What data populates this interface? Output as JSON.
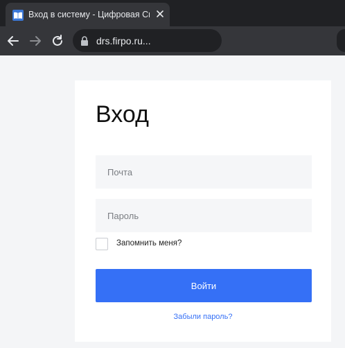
{
  "browser": {
    "tab_title": "Вход в систему - Цифровая Сис",
    "url": "drs.firpo.ru...",
    "accent_color": "#3b78d8"
  },
  "login": {
    "heading": "Вход",
    "email_placeholder": "Почта",
    "password_placeholder": "Пароль",
    "remember_label": "Запомнить меня?",
    "submit_label": "Войти",
    "forgot_link": "Забыли пароль?",
    "button_color": "#3570f6"
  }
}
